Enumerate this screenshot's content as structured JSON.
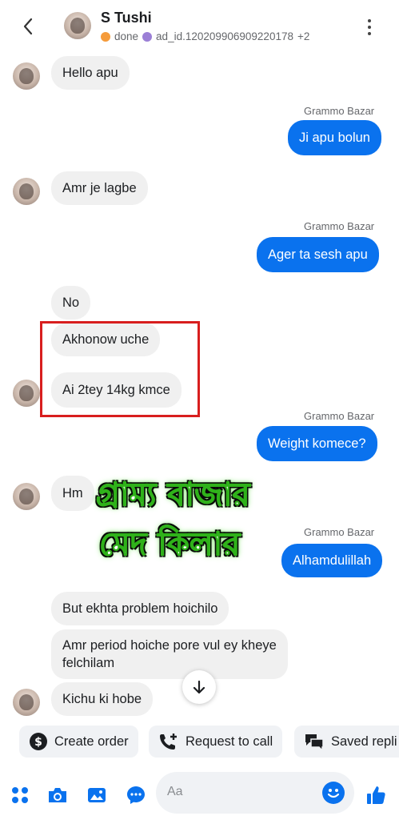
{
  "header": {
    "title": "S Tushi",
    "tag_done": "done",
    "tag_ad": "ad_id.120209906909220178",
    "tag_more": "+2",
    "tag_colors": {
      "done": "#f59b3a",
      "ad": "#9b7fd6"
    }
  },
  "messages": [
    {
      "id": "m1",
      "dir": "in",
      "text": "Hello apu"
    },
    {
      "id": "m2",
      "dir": "out",
      "sender": "Grammo Bazar",
      "text": "Ji apu bolun"
    },
    {
      "id": "m3",
      "dir": "in",
      "text": "Amr je lagbe"
    },
    {
      "id": "m4",
      "dir": "out",
      "sender": "Grammo Bazar",
      "text": "Ager ta sesh apu"
    },
    {
      "id": "m5",
      "dir": "in",
      "text": "No"
    },
    {
      "id": "m6",
      "dir": "in",
      "text": "Akhonow uche"
    },
    {
      "id": "m7",
      "dir": "in",
      "text": "Ai 2tey 14kg kmce"
    },
    {
      "id": "m8",
      "dir": "out",
      "sender": "Grammo Bazar",
      "text": "Weight komece?"
    },
    {
      "id": "m9",
      "dir": "in",
      "text": "Hm"
    },
    {
      "id": "m10",
      "dir": "out",
      "sender": "Grammo Bazar",
      "text": "Alhamdulillah"
    },
    {
      "id": "m11",
      "dir": "in",
      "text": "But ekhta problem hoichilo"
    },
    {
      "id": "m12a",
      "dir": "in",
      "text": "Amr period hoiche pore vul ey kheye"
    },
    {
      "id": "m12b",
      "dir": "in",
      "text": "felchilam"
    },
    {
      "id": "m13",
      "dir": "in",
      "text": "Kichu ki hobe"
    }
  ],
  "overlay": {
    "line1": "গ্রাম্য বাজার",
    "line2": "মেদ কিলার"
  },
  "quick_actions": {
    "create_order": "Create order",
    "request_call": "Request to call",
    "saved_replies": "Saved repli"
  },
  "composer": {
    "placeholder": "Aa"
  },
  "colors": {
    "outgoing_bubble": "#0a72ee",
    "incoming_bubble": "#f0f0f0",
    "highlight_box": "#d81e1e",
    "overlay_glow": "#47d62a"
  }
}
